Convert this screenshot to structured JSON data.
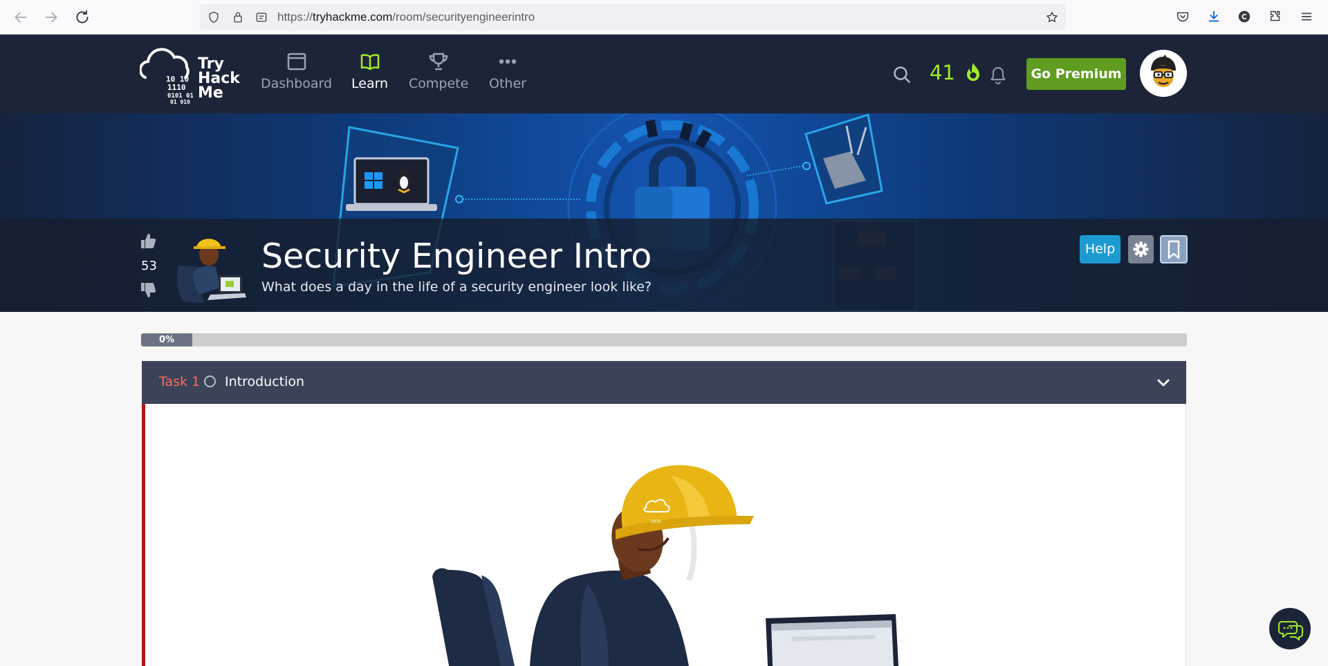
{
  "browser": {
    "url_prefix": "https://",
    "url_host": "tryhackme.com",
    "url_path": "/room/securityengineerintro"
  },
  "header": {
    "logo_text": "Try Hack Me",
    "logo_line1": "Try",
    "logo_line2": "Hack",
    "logo_line3": "Me",
    "nav": [
      {
        "label": "Dashboard",
        "icon": "dashboard-icon"
      },
      {
        "label": "Learn",
        "icon": "book-icon",
        "active": true
      },
      {
        "label": "Compete",
        "icon": "trophy-icon"
      },
      {
        "label": "Other",
        "icon": "dots-icon"
      }
    ],
    "streak": "41",
    "premium_label": "Go Premium"
  },
  "room": {
    "title": "Security Engineer Intro",
    "subtitle": "What does a day in the life of a security engineer look like?",
    "votes": "53",
    "help_label": "Help"
  },
  "progress": {
    "label": "0%",
    "value": 0
  },
  "task": {
    "number": "Task 1",
    "title": "Introduction"
  },
  "colors": {
    "header_bg": "#1c2538",
    "accent_green": "#a3ea2a",
    "premium_green": "#5f9c1f",
    "help_blue": "#1d9bd1",
    "task_red": "#ff6b5c"
  }
}
